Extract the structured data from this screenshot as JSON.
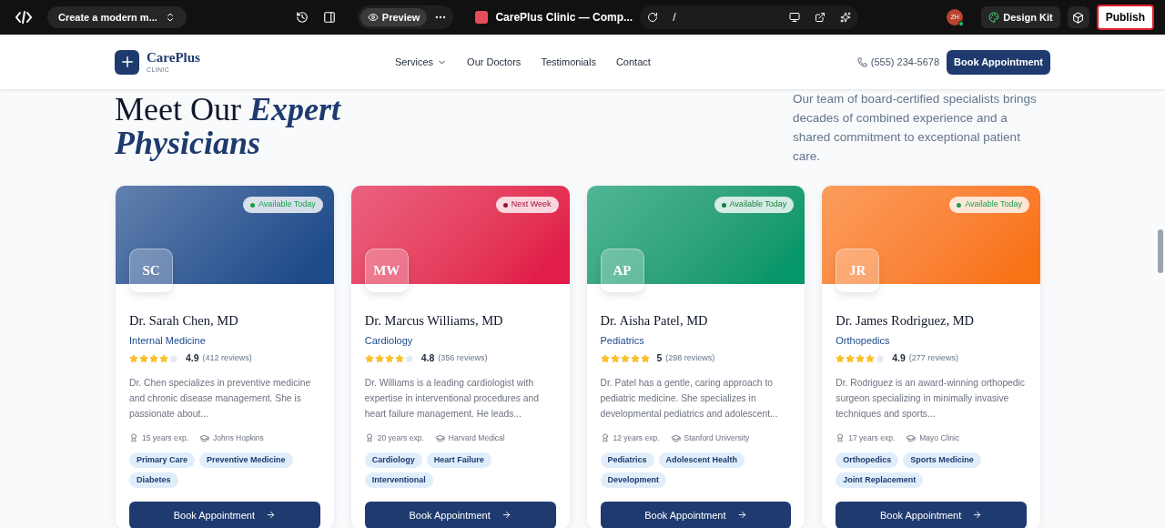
{
  "editor_bar": {
    "project": "Create a modern m...",
    "preview": {
      "label": "Preview",
      "selected": true
    },
    "tab_title": "CarePlus Clinic — Comp...",
    "url": "/",
    "avatar": "ZH",
    "design_kit": "Design Kit",
    "publish": "Publish"
  },
  "site_header": {
    "logo": {
      "name": "CarePlus",
      "tagline": "CLINIC"
    },
    "nav": [
      {
        "label": "Services",
        "dropdown": true
      },
      {
        "label": "Our Doctors",
        "dropdown": false
      },
      {
        "label": "Testimonials",
        "dropdown": false
      },
      {
        "label": "Contact",
        "dropdown": false
      }
    ],
    "phone": "(555) 234-5678",
    "cta": "Book Appointment"
  },
  "intro": {
    "heading": "Meet Our",
    "heading_accent": "Expert Physicians",
    "text": "Our team of board-certified specialists brings decades of combined experience and a shared commitment to exceptional patient care."
  },
  "doctors": [
    {
      "initials": "SC",
      "banner": {
        "color": "#1e4a8a"
      },
      "badge": {
        "text": "Available Today",
        "color": "#16a34a"
      },
      "name": "Dr. Sarah Chen, MD",
      "specialty": "Internal Medicine",
      "stars": 4,
      "rating": "4.9",
      "reviews": "(412 reviews)",
      "bio": "Dr. Chen specializes in preventive medicine and chronic disease management. She is passionate about...",
      "experience": "15 years exp.",
      "school": "Johns Hopkins",
      "tags": [
        "Primary Care",
        "Preventive Medicine",
        "Diabetes"
      ],
      "button": "Book Appointment"
    },
    {
      "initials": "MW",
      "banner": {
        "color": "#e11d48"
      },
      "badge": {
        "text": "Next Week",
        "color": "#9f1239"
      },
      "name": "Dr. Marcus Williams, MD",
      "specialty": "Cardiology",
      "stars": 4,
      "rating": "4.8",
      "reviews": "(356 reviews)",
      "bio": "Dr. Williams is a leading cardiologist with expertise in interventional procedures and heart failure management. He leads...",
      "experience": "20 years exp.",
      "school": "Harvard Medical",
      "tags": [
        "Cardiology",
        "Heart Failure",
        "Interventional"
      ],
      "button": "Book Appointment"
    },
    {
      "initials": "AP",
      "banner": {
        "color": "#059669"
      },
      "badge": {
        "text": "Available Today",
        "color": "#15803d"
      },
      "name": "Dr. Aisha Patel, MD",
      "specialty": "Pediatrics",
      "stars": 5,
      "rating": "5",
      "reviews": "(298 reviews)",
      "bio": "Dr. Patel has a gentle, caring approach to pediatric medicine. She specializes in developmental pediatrics and adolescent...",
      "experience": "12 years exp.",
      "school": "Stanford University",
      "tags": [
        "Pediatrics",
        "Adolescent Health",
        "Development"
      ],
      "button": "Book Appointment"
    },
    {
      "initials": "JR",
      "banner": {
        "color": "#f97316"
      },
      "badge": {
        "text": "Available Today",
        "color": "#16a34a"
      },
      "name": "Dr. James Rodriguez, MD",
      "specialty": "Orthopedics",
      "stars": 4,
      "rating": "4.9",
      "reviews": "(277 reviews)",
      "bio": "Dr. Rodriguez is an award-winning orthopedic surgeon specializing in minimally invasive techniques and sports...",
      "experience": "17 years exp.",
      "school": "Mayo Clinic",
      "tags": [
        "Orthopedics",
        "Sports Medicine",
        "Joint Replacement"
      ],
      "button": "Book Appointment"
    }
  ]
}
